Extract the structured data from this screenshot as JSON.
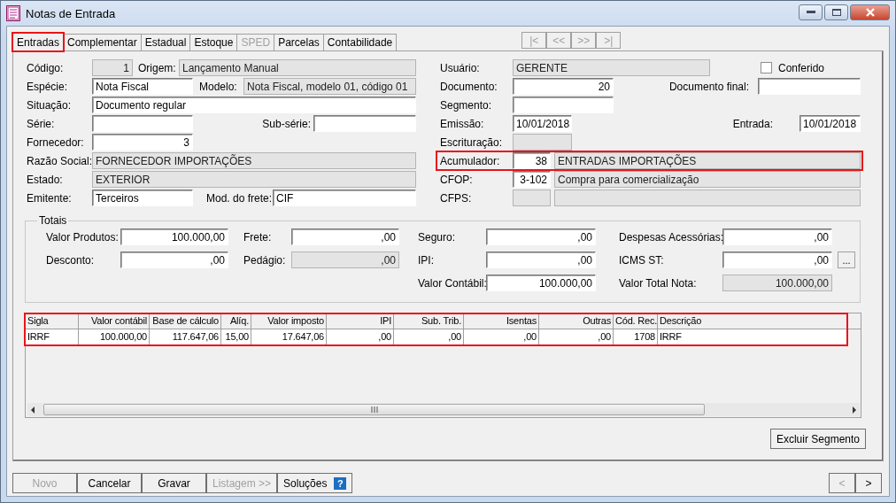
{
  "window": {
    "title": "Notas de Entrada"
  },
  "tabs": [
    {
      "label": "Entradas",
      "selected": true,
      "disabled": false,
      "highlighted": true
    },
    {
      "label": "Complementar",
      "selected": false,
      "disabled": false
    },
    {
      "label": "Estadual",
      "selected": false,
      "disabled": false
    },
    {
      "label": "Estoque",
      "selected": false,
      "disabled": false
    },
    {
      "label": "SPED",
      "selected": false,
      "disabled": true
    },
    {
      "label": "Parcelas",
      "selected": false,
      "disabled": false
    },
    {
      "label": "Contabilidade",
      "selected": false,
      "disabled": false
    }
  ],
  "record_nav": [
    {
      "label": "|<",
      "disabled": true
    },
    {
      "label": "<<",
      "disabled": true
    },
    {
      "label": ">>",
      "disabled": true
    },
    {
      "label": ">|",
      "disabled": true
    }
  ],
  "left_rows": [
    {
      "items": [
        {
          "label": "Código:",
          "value": "1",
          "readonly": true
        },
        {
          "label": "Origem:",
          "value": "Lançamento Manual",
          "readonly": true
        }
      ]
    },
    {
      "items": [
        {
          "label": "Espécie:",
          "value": "Nota Fiscal",
          "readonly": false
        },
        {
          "label": "Modelo:",
          "value": "Nota Fiscal, modelo 01, código 01",
          "readonly": true
        }
      ]
    },
    {
      "items": [
        {
          "label": "Situação:",
          "value": "Documento regular",
          "readonly": false
        }
      ]
    },
    {
      "items": [
        {
          "label": "Série:",
          "readonly": false
        },
        {
          "label": "Sub-série:",
          "readonly": false
        }
      ]
    },
    {
      "items": [
        {
          "label": "Fornecedor:",
          "value": "3",
          "readonly": false
        }
      ]
    },
    {
      "items": [
        {
          "label": "Razão Social:",
          "value": "FORNECEDOR IMPORTAÇÕES",
          "readonly": true
        }
      ]
    },
    {
      "items": [
        {
          "label": "Estado:",
          "value": "EXTERIOR",
          "readonly": true
        }
      ]
    },
    {
      "items": [
        {
          "label": "Emitente:",
          "value": "Terceiros",
          "readonly": false
        },
        {
          "label": "Mod. do frete:",
          "value": "CIF",
          "readonly": false
        }
      ]
    }
  ],
  "right_rows": [
    {
      "items": [
        {
          "label": "Usuário:",
          "value": "GERENTE",
          "readonly": true
        },
        {
          "kind": "checkbox",
          "label": "Conferido",
          "checked": false
        }
      ]
    },
    {
      "items": [
        {
          "label": "Documento:",
          "value": "20",
          "readonly": false
        },
        {
          "label": "Documento final:",
          "readonly": false
        }
      ]
    },
    {
      "items": [
        {
          "label": "Segmento:",
          "readonly": false
        }
      ]
    },
    {
      "items": [
        {
          "label": "Emissão:",
          "value": "10/01/2018",
          "readonly": false
        },
        {
          "label": "Entrada:",
          "value": "10/01/2018",
          "readonly": false
        }
      ]
    },
    {
      "items": [
        {
          "label": "Escrituração:",
          "readonly": true
        }
      ]
    },
    {
      "highlighted": true,
      "items": [
        {
          "label": "Acumulador:",
          "value": "38",
          "readonly": false
        },
        {
          "value": "ENTRADAS IMPORTAÇÕES",
          "readonly": true
        }
      ]
    },
    {
      "items": [
        {
          "label": "CFOP:",
          "value": "3-102",
          "readonly": false
        },
        {
          "value": "Compra para comercialização",
          "readonly": true
        }
      ]
    },
    {
      "items": [
        {
          "label": "CFPS:",
          "readonly": true
        },
        {
          "readonly": true
        }
      ]
    }
  ],
  "totals": {
    "title": "Totais",
    "columns": [
      [
        {
          "label": "Valor Produtos:",
          "value": "100.000,00",
          "readonly": false
        },
        {
          "label": "Desconto:",
          "value": ",00",
          "readonly": false
        }
      ],
      [
        {
          "label": "Frete:",
          "value": ",00",
          "readonly": false
        },
        {
          "label": "Pedágio:",
          "value": ",00",
          "readonly": true
        }
      ],
      [
        {
          "label": "Seguro:",
          "value": ",00",
          "readonly": false
        },
        {
          "label": "IPI:",
          "value": ",00",
          "readonly": false
        },
        {
          "label": "Valor Contábil:",
          "value": "100.000,00",
          "readonly": false
        }
      ],
      [
        {
          "label": "Despesas Acessórias:",
          "value": ",00",
          "readonly": false
        },
        {
          "label": "ICMS ST:",
          "value": ",00",
          "readonly": false,
          "button": "..."
        },
        {
          "label": "Valor Total Nota:",
          "value": "100.000,00",
          "readonly": true
        }
      ]
    ]
  },
  "grid": {
    "highlighted": true,
    "columns": [
      "Sigla",
      "Valor contábil",
      "Base de cálculo",
      "Alíq.",
      "Valor imposto",
      "IPI",
      "Sub. Trib.",
      "Isentas",
      "Outras",
      "Cód. Rec.",
      "Descrição"
    ],
    "rows": [
      [
        "IRRF",
        "100.000,00",
        "117.647,06",
        "15,00",
        "17.647,06",
        ",00",
        ",00",
        ",00",
        ",00",
        "1708",
        "IRRF"
      ]
    ]
  },
  "panel_button": "Excluir Segmento",
  "buttons": [
    {
      "label": "Novo",
      "disabled": true
    },
    {
      "label": "Cancelar",
      "disabled": false
    },
    {
      "label": "Gravar",
      "disabled": false
    },
    {
      "label": "Listagem >>",
      "disabled": true
    },
    {
      "label": "Soluções",
      "disabled": false,
      "kind": "help",
      "icon_text": "?"
    }
  ],
  "page_nav": [
    {
      "label": "<",
      "disabled": true
    },
    {
      "label": ">",
      "disabled": false
    }
  ]
}
